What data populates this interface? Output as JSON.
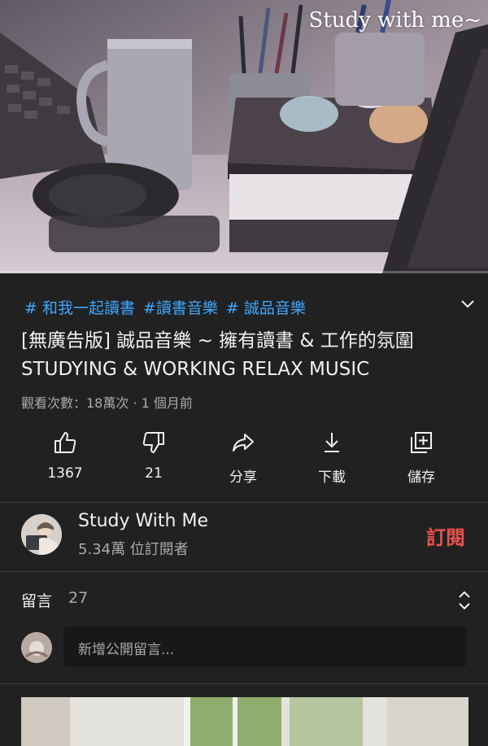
{
  "video": {
    "overlay_title": "Study with me~",
    "progress": 0.0
  },
  "hashtags": [
    "# 和我一起讀書",
    "#讀書音樂",
    "# 誠品音樂"
  ],
  "title": "[無廣告版] 誠品音樂 ~ 擁有讀書 & 工作的氛圍  STUDYING & WORKING RELAX MUSIC",
  "meta": "觀看次數：18萬次 · 1 個月前",
  "actions": {
    "like": "1367",
    "dislike": "21",
    "share": "分享",
    "download": "下載",
    "save": "儲存"
  },
  "channel": {
    "name": "Study With Me",
    "subscribers": "5.34萬 位訂閱者",
    "subscribe_label": "訂閱"
  },
  "comments": {
    "label": "留言",
    "count": "27",
    "placeholder": "新增公開留言..."
  },
  "colors": {
    "background": "#212121",
    "hashtag": "#3ea6ff",
    "subscribe": "#e9524a",
    "progress": "#ff0000"
  },
  "icons": [
    "thumb-up-icon",
    "thumb-down-icon",
    "share-icon",
    "download-icon",
    "save-playlist-icon",
    "chevron-down-icon",
    "sort-toggle-icon"
  ]
}
